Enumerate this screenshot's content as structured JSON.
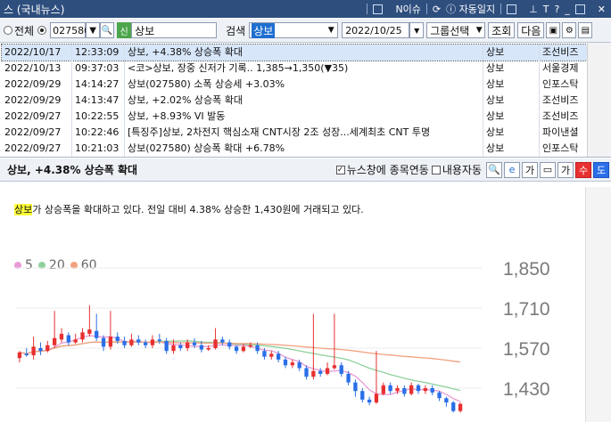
{
  "window": {
    "title": "스 (국내뉴스)",
    "buttons": [
      "N이슈",
      "자동일지",
      "T",
      "?"
    ]
  },
  "toolbar": {
    "radio_all": "전체",
    "radio_code": "",
    "code_value": "027580",
    "new_badge": "신",
    "name_value": "상보",
    "search_label": "검색",
    "search_value": "상보",
    "date_value": "2022/10/25",
    "group_select": "그룹선택",
    "lookup_button": "조회",
    "next_button": "다음"
  },
  "news_list": {
    "rows": [
      {
        "date": "2022/10/17",
        "time": "12:33:09",
        "title": "상보, +4.38% 상승폭 확대",
        "category": "상보",
        "source": "조선비즈",
        "selected": true
      },
      {
        "date": "2022/10/13",
        "time": "09:37:03",
        "title": "<코>상보, 장중 신저가 기록.. 1,385→1,350(▼35)",
        "category": "상보",
        "source": "서울경제",
        "selected": false
      },
      {
        "date": "2022/09/29",
        "time": "14:14:27",
        "title": "상보(027580) 소폭 상승세 +3.03%",
        "category": "상보",
        "source": "인포스탁",
        "selected": false
      },
      {
        "date": "2022/09/29",
        "time": "14:13:47",
        "title": "상보, +2.02% 상승폭 확대",
        "category": "상보",
        "source": "조선비즈",
        "selected": false
      },
      {
        "date": "2022/09/27",
        "time": "10:22:55",
        "title": "상보, +8.93% VI 발동",
        "category": "상보",
        "source": "조선비즈",
        "selected": false
      },
      {
        "date": "2022/09/27",
        "time": "10:22:46",
        "title": "[특징주]상보, 2차전지 핵심소재 CNT시장 2조 성장...세계최초 CNT 투명",
        "category": "상보",
        "source": "파이낸셜",
        "selected": false
      },
      {
        "date": "2022/09/27",
        "time": "10:21:03",
        "title": "상보(027580) 상승폭 확대 +6.78%",
        "category": "상보",
        "source": "인포스탁",
        "selected": false
      }
    ]
  },
  "article": {
    "header_title": "상보, +4.38% 상승폭 확대",
    "opt_linked": "뉴스창에 종목연동",
    "opt_auto": "내용자동",
    "icon_font_up": "수",
    "icon_font_down": "도",
    "sentence_highlight": "상보",
    "sentence_rest": "가 상승폭을 확대하고 있다. 전일 대비 4.38% 상승한 1,430원에 거래되고 있다."
  },
  "chart_data": {
    "type": "candlestick",
    "legend": [
      {
        "label": "5",
        "color": "#e89ad6"
      },
      {
        "label": "20",
        "color": "#8fd19b"
      },
      {
        "label": "60",
        "color": "#f2a07f"
      }
    ],
    "ylim": [
      1290,
      1890
    ],
    "yticks": [
      "1,850",
      "1,710",
      "1,570",
      "1,430",
      "1,290"
    ],
    "up_color": "#e83030",
    "down_color": "#2a6fe8",
    "candles": [
      [
        1535,
        1555,
        1520,
        1560
      ],
      [
        1550,
        1545,
        1540,
        1570
      ],
      [
        1545,
        1575,
        1530,
        1610
      ],
      [
        1570,
        1560,
        1545,
        1590
      ],
      [
        1560,
        1580,
        1555,
        1595
      ],
      [
        1580,
        1605,
        1570,
        1700
      ],
      [
        1600,
        1620,
        1590,
        1640
      ],
      [
        1615,
        1590,
        1580,
        1625
      ],
      [
        1590,
        1600,
        1585,
        1620
      ],
      [
        1600,
        1625,
        1590,
        1640
      ],
      [
        1620,
        1635,
        1610,
        1720
      ],
      [
        1630,
        1605,
        1595,
        1690
      ],
      [
        1605,
        1575,
        1560,
        1615
      ],
      [
        1575,
        1610,
        1565,
        1700
      ],
      [
        1610,
        1595,
        1585,
        1625
      ],
      [
        1595,
        1580,
        1570,
        1610
      ],
      [
        1580,
        1600,
        1575,
        1620
      ],
      [
        1600,
        1590,
        1580,
        1615
      ],
      [
        1590,
        1580,
        1570,
        1600
      ],
      [
        1580,
        1600,
        1570,
        1615
      ],
      [
        1600,
        1595,
        1585,
        1620
      ],
      [
        1595,
        1560,
        1550,
        1605
      ],
      [
        1560,
        1580,
        1550,
        1600
      ],
      [
        1580,
        1570,
        1560,
        1590
      ],
      [
        1570,
        1590,
        1560,
        1600
      ],
      [
        1590,
        1580,
        1570,
        1605
      ],
      [
        1580,
        1565,
        1555,
        1595
      ],
      [
        1565,
        1570,
        1560,
        1580
      ],
      [
        1570,
        1600,
        1565,
        1640
      ],
      [
        1600,
        1590,
        1580,
        1610
      ],
      [
        1590,
        1575,
        1565,
        1600
      ],
      [
        1575,
        1560,
        1550,
        1580
      ],
      [
        1560,
        1575,
        1555,
        1585
      ],
      [
        1575,
        1580,
        1570,
        1590
      ],
      [
        1580,
        1560,
        1550,
        1590
      ],
      [
        1560,
        1540,
        1530,
        1570
      ],
      [
        1540,
        1550,
        1530,
        1560
      ],
      [
        1550,
        1530,
        1520,
        1560
      ],
      [
        1530,
        1510,
        1500,
        1540
      ],
      [
        1510,
        1520,
        1500,
        1530
      ],
      [
        1520,
        1500,
        1490,
        1530
      ],
      [
        1500,
        1470,
        1460,
        1510
      ],
      [
        1470,
        1490,
        1460,
        1690
      ],
      [
        1490,
        1480,
        1470,
        1500
      ],
      [
        1480,
        1500,
        1475,
        1520
      ],
      [
        1500,
        1510,
        1495,
        1690
      ],
      [
        1510,
        1480,
        1470,
        1520
      ],
      [
        1480,
        1450,
        1440,
        1490
      ],
      [
        1450,
        1420,
        1400,
        1460
      ],
      [
        1420,
        1390,
        1380,
        1430
      ],
      [
        1390,
        1380,
        1370,
        1400
      ],
      [
        1380,
        1410,
        1375,
        1560
      ],
      [
        1410,
        1440,
        1405,
        1450
      ],
      [
        1440,
        1420,
        1410,
        1450
      ],
      [
        1420,
        1430,
        1410,
        1440
      ],
      [
        1430,
        1410,
        1400,
        1440
      ],
      [
        1410,
        1440,
        1405,
        1450
      ],
      [
        1440,
        1420,
        1410,
        1445
      ],
      [
        1420,
        1430,
        1410,
        1440
      ],
      [
        1430,
        1415,
        1405,
        1440
      ],
      [
        1415,
        1395,
        1385,
        1420
      ],
      [
        1395,
        1380,
        1365,
        1400
      ],
      [
        1380,
        1350,
        1345,
        1385
      ],
      [
        1350,
        1375,
        1345,
        1380
      ]
    ]
  }
}
